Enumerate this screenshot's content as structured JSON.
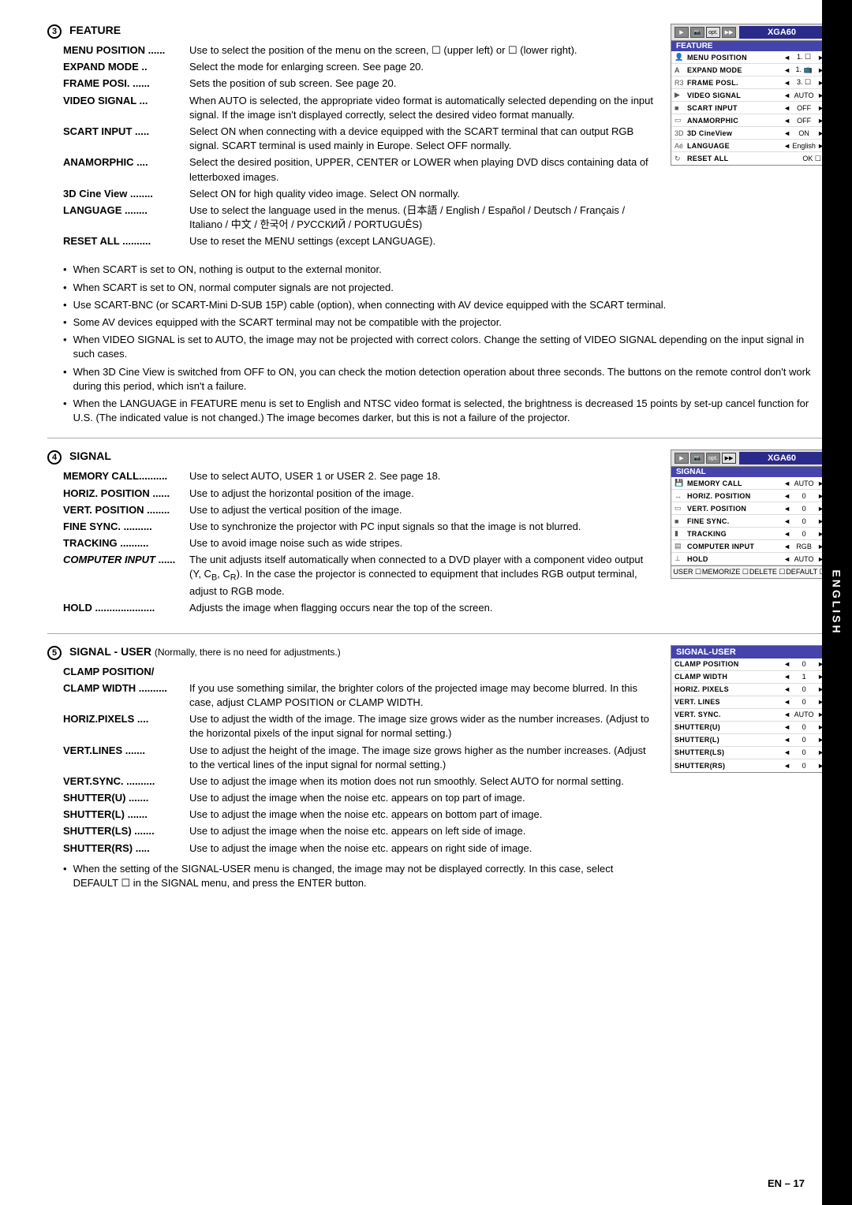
{
  "page": {
    "number": "EN – 17",
    "sidebar_label": "ENGLISH"
  },
  "feature_section": {
    "number": "3",
    "title": "FEATURE",
    "entries": [
      {
        "term": "MENU POSITION",
        "desc": "Use to select the position of the menu on the screen, □ (upper left) or □ (lower right)."
      },
      {
        "term": "EXPAND MODE",
        "desc": "Select the mode for enlarging screen. See page 20."
      },
      {
        "term": "FRAME POSI.",
        "desc": "Sets the position of sub screen. See page 20."
      },
      {
        "term": "VIDEO SIGNAL",
        "desc": "When AUTO is selected, the appropriate video format is automatically selected depending on the input signal. If the image isn't displayed correctly, select the desired video format manually."
      },
      {
        "term": "SCART INPUT",
        "desc": "Select ON when connecting with a device equipped with the SCART terminal that can output RGB signal. SCART terminal is used mainly in Europe. Select OFF normally."
      },
      {
        "term": "ANAMORPHIC",
        "desc": "Select the desired position, UPPER, CENTER or LOWER when playing DVD discs containing data of letterboxed images."
      },
      {
        "term": "3D Cine View",
        "desc": "Select ON for high quality video image. Select ON normally."
      },
      {
        "term": "LANGUAGE",
        "desc": "Use to select the language used in the menus. (日本語 / English / Español / Deutsch / Français / Italiano / 中文 / 한국어 / РУССКИЙ / PORTUGUÊS)"
      },
      {
        "term": "RESET ALL",
        "desc": "Use to reset the MENU settings (except LANGUAGE)."
      }
    ],
    "bullets": [
      "When SCART is set to ON, nothing is output to the external monitor.",
      "When SCART is set to ON, normal computer signals are not projected.",
      "Use SCART-BNC (or SCART-Mini D-SUB 15P) cable (option), when connecting with AV device equipped with the SCART terminal.",
      "Some AV devices equipped with the SCART terminal may not be compatible with the projector.",
      "When VIDEO SIGNAL is set to AUTO, the image may not be projected with correct colors. Change the setting of VIDEO SIGNAL depending on the input signal in such cases.",
      "When 3D Cine View is switched from OFF to ON, you can check the motion detection operation about three seconds. The buttons on the remote control don't work during this period, which isn't a failure.",
      "When the LANGUAGE in FEATURE menu is set to English and NTSC video format is selected, the brightness is decreased 15 points by set-up cancel function for U.S. (The indicated value is not changed.) The image becomes darker, but this is not a failure of the projector."
    ],
    "menu": {
      "title": "XGA60",
      "section": "FEATURE",
      "rows": [
        {
          "icon": "person",
          "name": "MENU POSITION",
          "value": "1. □",
          "has_arrows": true
        },
        {
          "icon": "A",
          "name": "EXPAND MODE",
          "value": "1. 🖼",
          "has_arrows": true
        },
        {
          "icon": "R3",
          "name": "FRAME POSL.",
          "value": "3. □",
          "has_arrows": true
        },
        {
          "icon": "video",
          "name": "VIDEO SIGNAL",
          "value": "AUTO",
          "has_arrows": true
        },
        {
          "icon": "scart",
          "name": "SCART INPUT",
          "value": "OFF",
          "has_arrows": true
        },
        {
          "icon": "ana",
          "name": "ANAMORPHIC",
          "value": "OFF",
          "has_arrows": true
        },
        {
          "icon": "3d",
          "name": "3D CineView",
          "value": "ON",
          "has_arrows": true
        },
        {
          "icon": "lang",
          "name": "LANGUAGE",
          "value": "English",
          "has_arrows": true
        },
        {
          "icon": "reset",
          "name": "RESET ALL",
          "value": "OK □",
          "has_arrows": false
        }
      ]
    }
  },
  "signal_section": {
    "number": "4",
    "title": "SIGNAL",
    "entries": [
      {
        "term": "MEMORY CALL",
        "desc": "Use to select AUTO, USER 1 or USER 2. See page 18."
      },
      {
        "term": "HORIZ. POSITION",
        "desc": "Use to adjust the horizontal position of the image."
      },
      {
        "term": "VERT. POSITION",
        "desc": "Use to adjust the vertical position of the image."
      },
      {
        "term": "FINE SYNC.",
        "desc": "Use to synchronize the projector with PC input signals so that the image is not blurred."
      },
      {
        "term": "TRACKING",
        "desc": "Use to avoid image noise such as wide stripes."
      },
      {
        "term": "COMPUTER INPUT",
        "desc": "The unit adjusts itself automatically when connected to a DVD player with a component video output (Y, CB, CR). In the case the projector is connected to equipment that includes RGB output terminal, adjust to RGB mode."
      },
      {
        "term": "HOLD",
        "desc": "Adjusts the image when flagging occurs near the top of the screen."
      }
    ],
    "menu": {
      "title": "XGA60",
      "section": "SIGNAL",
      "rows": [
        {
          "name": "MEMORY CALL",
          "value": "AUTO"
        },
        {
          "name": "HORIZ. POSITION",
          "value": "0"
        },
        {
          "name": "VERT. POSITION",
          "value": "0"
        },
        {
          "name": "FINE SYNC.",
          "value": "0"
        },
        {
          "name": "TRACKING",
          "value": "0"
        },
        {
          "name": "COMPUTER INPUT",
          "value": "RGB"
        },
        {
          "name": "HOLD",
          "value": "AUTO"
        }
      ],
      "footer": [
        "USER □",
        "MEMORIZE □",
        "DELETE □",
        "DEFAULT □"
      ]
    }
  },
  "signal_user_section": {
    "number": "5",
    "title": "SIGNAL - USER",
    "note": "(Normally, there is no need for adjustments.)",
    "entries": [
      {
        "term": "CLAMP POSITION/",
        "desc": ""
      },
      {
        "term": "CLAMP WIDTH",
        "desc": "If you use something similar, the brighter colors of the projected image may become blurred. In this case, adjust CLAMP POSITION or CLAMP WIDTH."
      },
      {
        "term": "HORIZ.PIXELS",
        "desc": "Use to adjust the width of the image. The image size grows wider as the number increases. (Adjust to the horizontal pixels of the input signal for normal setting.)"
      },
      {
        "term": "VERT.LINES",
        "desc": "Use to adjust the height of the image. The image size grows higher as the number increases. (Adjust to the vertical lines of the input signal for normal setting.)"
      },
      {
        "term": "VERT.SYNC.",
        "desc": "Use to adjust the image when its motion does not run smoothly. Select AUTO for normal setting."
      },
      {
        "term": "SHUTTER(U)",
        "desc": "Use to adjust the image when the noise etc. appears on top part of image."
      },
      {
        "term": "SHUTTER(L)",
        "desc": "Use to adjust the image when the noise etc. appears on bottom part of image."
      },
      {
        "term": "SHUTTER(LS)",
        "desc": "Use to adjust the image when the noise etc. appears on left side of image."
      },
      {
        "term": "SHUTTER(RS)",
        "desc": "Use to adjust the image when the noise etc. appears on right side of image."
      }
    ],
    "bullet": "When the setting of the SIGNAL-USER menu is changed, the image may not be displayed correctly. In this case, select DEFAULT □ in the SIGNAL menu, and press the ENTER button.",
    "menu": {
      "section": "SIGNAL-USER",
      "rows": [
        {
          "name": "CLAMP POSITION",
          "value": "0"
        },
        {
          "name": "CLAMP WIDTH",
          "value": "1"
        },
        {
          "name": "HORIZ. PIXELS",
          "value": "0"
        },
        {
          "name": "VERT. LINES",
          "value": "0"
        },
        {
          "name": "VERT. SYNC.",
          "value": "AUTO"
        },
        {
          "name": "SHUTTER(U)",
          "value": "0"
        },
        {
          "name": "SHUTTER(L)",
          "value": "0"
        },
        {
          "name": "SHUTTER(LS)",
          "value": "0"
        },
        {
          "name": "SHUTTER(RS)",
          "value": "0"
        }
      ]
    }
  }
}
